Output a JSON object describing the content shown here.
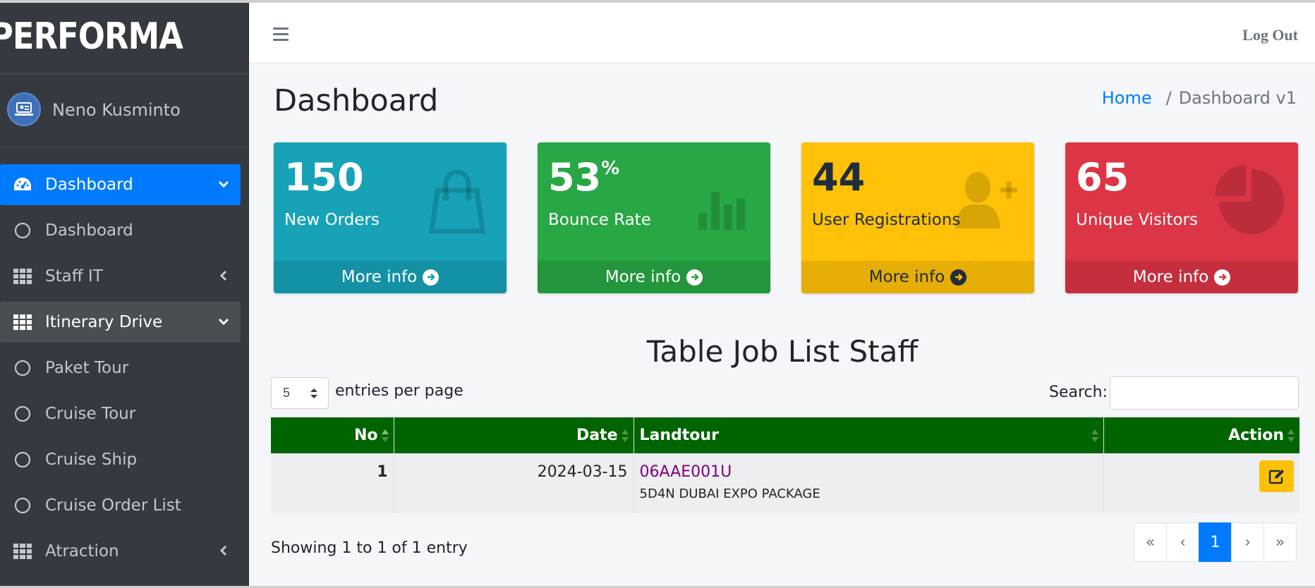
{
  "brand": {
    "name": "PERFORMA"
  },
  "user": {
    "name": "Neno Kusminto"
  },
  "sidebar": {
    "items": [
      {
        "label": "Dashboard",
        "icon": "tachometer-icon",
        "state": "active",
        "arrow": "chevron-down"
      },
      {
        "label": "Dashboard",
        "icon": "circle-icon",
        "state": "normal",
        "arrow": ""
      },
      {
        "label": "Staff IT",
        "icon": "grid-icon",
        "state": "normal",
        "arrow": "chevron-left"
      },
      {
        "label": "Itinerary Drive",
        "icon": "grid-icon",
        "state": "open",
        "arrow": "chevron-down"
      },
      {
        "label": "Paket Tour",
        "icon": "circle-icon",
        "state": "normal",
        "arrow": ""
      },
      {
        "label": "Cruise Tour",
        "icon": "circle-icon",
        "state": "normal",
        "arrow": ""
      },
      {
        "label": "Cruise Ship",
        "icon": "circle-icon",
        "state": "normal",
        "arrow": ""
      },
      {
        "label": "Cruise Order List",
        "icon": "circle-icon",
        "state": "normal",
        "arrow": ""
      },
      {
        "label": "Atraction",
        "icon": "grid-icon",
        "state": "normal",
        "arrow": "chevron-left"
      }
    ]
  },
  "topbar": {
    "logout_label": "Log Out"
  },
  "page": {
    "title": "Dashboard",
    "breadcrumb": {
      "home": "Home",
      "separator": "/",
      "current": "Dashboard v1"
    }
  },
  "stats": [
    {
      "number": "150",
      "suffix": "",
      "label": "New Orders",
      "footer": "More info",
      "icon": "shopping-bag-icon",
      "color": "#17a2b8"
    },
    {
      "number": "53",
      "suffix": "%",
      "label": "Bounce Rate",
      "footer": "More info",
      "icon": "bar-chart-icon",
      "color": "#28a745"
    },
    {
      "number": "44",
      "suffix": "",
      "label": "User Registrations",
      "footer": "More info",
      "icon": "user-plus-icon",
      "color": "#ffc107"
    },
    {
      "number": "65",
      "suffix": "",
      "label": "Unique Visitors",
      "footer": "More info",
      "icon": "pie-chart-icon",
      "color": "#dc3545"
    }
  ],
  "table": {
    "title": "Table Job List Staff",
    "per_page_value": "5",
    "per_page_label": "entries per page",
    "search_label": "Search:",
    "search_value": "",
    "columns": [
      "No",
      "Date",
      "Landtour",
      "Action"
    ],
    "rows": [
      {
        "no": "1",
        "date": "2024-03-15",
        "landtour_code": "06AAE001U",
        "landtour_name": "5D4N DUBAI EXPO PACKAGE"
      }
    ],
    "showing": "Showing 1 to 1 of 1 entry",
    "pagination": [
      "«",
      "‹",
      "1",
      "›",
      "»"
    ],
    "current_page": "1"
  },
  "colors": {
    "sidebar": "#343a40",
    "primary": "#007bff",
    "table_header": "#006400",
    "content_bg": "#f4f6f9"
  }
}
